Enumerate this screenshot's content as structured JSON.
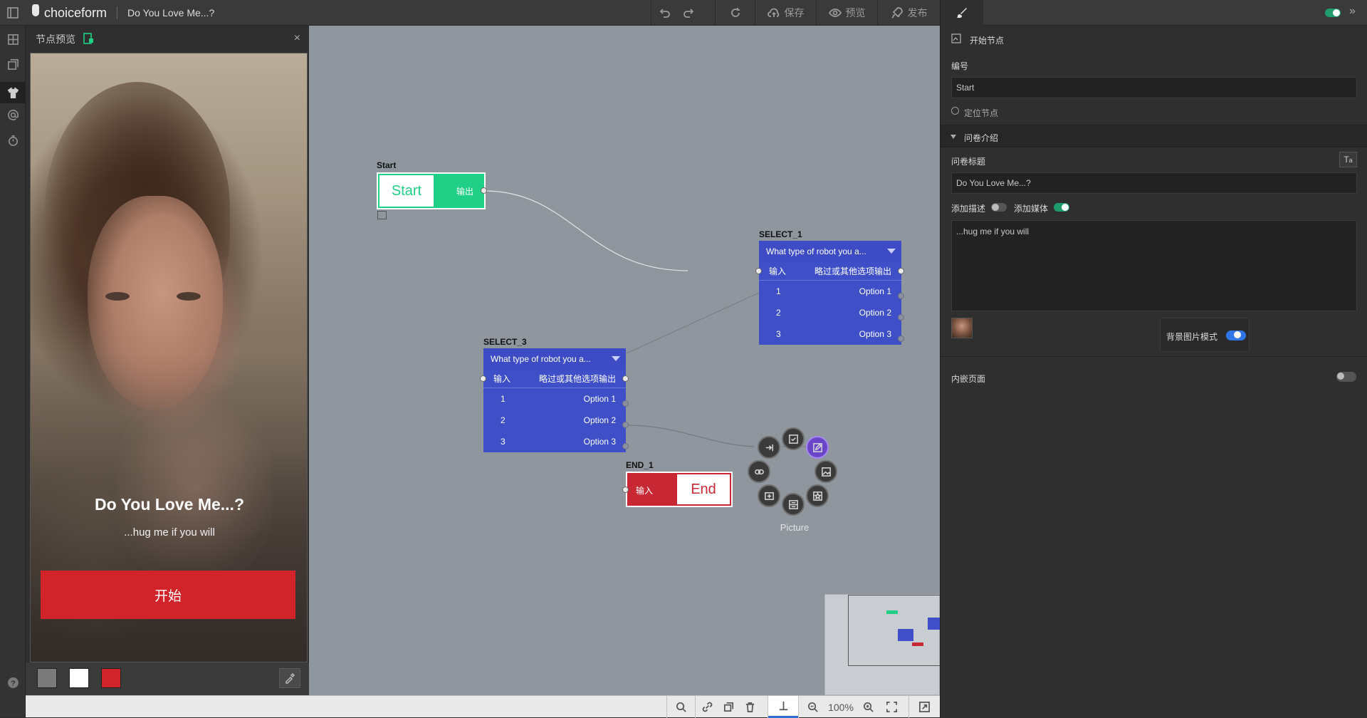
{
  "app": {
    "name": "choiceform",
    "doc_title": "Do You Love Me...?"
  },
  "toolbar": {
    "save": "保存",
    "preview": "预览",
    "publish": "发布"
  },
  "preview_panel": {
    "title": "节点预览",
    "phone": {
      "title": "Do You Love Me...?",
      "description": "...hug me if you will",
      "start_button": "开始"
    },
    "swatches": [
      "#7a7a7a",
      "#ffffff",
      "#d0232a"
    ]
  },
  "canvas": {
    "start_node": {
      "label": "Start",
      "title": "Start",
      "output": "输出"
    },
    "select_1": {
      "label": "SELECT_1",
      "question": "What type of robot you a...",
      "input": "输入",
      "skip_output": "略过或其他选项输出",
      "options": [
        {
          "num": "1",
          "text": "Option 1"
        },
        {
          "num": "2",
          "text": "Option 2"
        },
        {
          "num": "3",
          "text": "Option 3"
        }
      ]
    },
    "select_3": {
      "label": "SELECT_3",
      "question": "What type of robot you a...",
      "input": "输入",
      "skip_output": "略过或其他选项输出",
      "options": [
        {
          "num": "1",
          "text": "Option 1"
        },
        {
          "num": "2",
          "text": "Option 2"
        },
        {
          "num": "3",
          "text": "Option 3"
        }
      ]
    },
    "end_node": {
      "label": "END_1",
      "input": "输入",
      "title": "End"
    },
    "radial_menu": {
      "caption": "Picture"
    }
  },
  "bottombar": {
    "zoom": "100%"
  },
  "right_panel": {
    "node_type": "开始节点",
    "id_label": "编号",
    "id_value": "Start",
    "locate": "定位节点",
    "section": "问卷介绍",
    "survey_title_label": "问卷标题",
    "survey_title_value": "Do You Love Me...?",
    "add_desc": "添加描述",
    "add_media": "添加媒体",
    "description_value": "...hug me if you will",
    "bg_mode": "背景图片模式",
    "embed_page": "内嵌页面"
  },
  "colors": {
    "accent_green": "#1fcf85",
    "node_blue": "#3f4fc8",
    "end_red": "#c82833",
    "start_red": "#d0232a"
  }
}
